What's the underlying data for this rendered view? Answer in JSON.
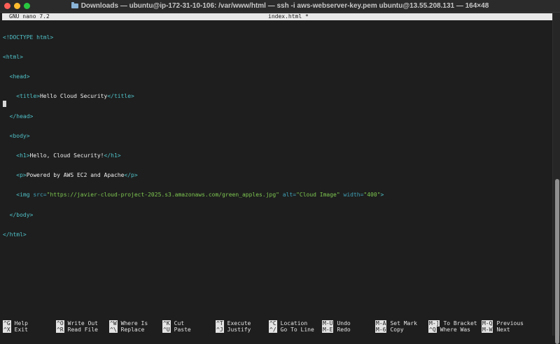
{
  "window": {
    "title": "Downloads — ubuntu@ip-172-31-10-106: /var/www/html — ssh -i aws-webserver-key.pem ubuntu@13.55.208.131 — 164×48"
  },
  "nano": {
    "version": "GNU nano 7.2",
    "filename": "index.html *"
  },
  "code_lines": [
    "<!DOCTYPE html>",
    "<html>",
    "  <head>",
    "    <title>Hello Cloud Security</title>",
    "  </head>",
    "  <body>",
    "    <h1>Hello, Cloud Security!</h1>",
    "    <p>Powered by AWS EC2 and Apache</p>",
    "    <img src=\"https://javier-cloud-project-2025.s3.amazonaws.com/green_apples.jpg\" alt=\"Cloud Image\" width=\"400\">",
    "  </body>",
    "</html>"
  ],
  "shortcuts": [
    {
      "key": "^G",
      "label": "Help"
    },
    {
      "key": "^X",
      "label": "Exit"
    },
    {
      "key": "^O",
      "label": "Write Out"
    },
    {
      "key": "^R",
      "label": "Read File"
    },
    {
      "key": "^W",
      "label": "Where Is"
    },
    {
      "key": "^\\",
      "label": "Replace"
    },
    {
      "key": "^K",
      "label": "Cut"
    },
    {
      "key": "^U",
      "label": "Paste"
    },
    {
      "key": "^T",
      "label": "Execute"
    },
    {
      "key": "^J",
      "label": "Justify"
    },
    {
      "key": "^C",
      "label": "Location"
    },
    {
      "key": "^/",
      "label": "Go To Line"
    },
    {
      "key": "M-U",
      "label": "Undo"
    },
    {
      "key": "M-E",
      "label": "Redo"
    },
    {
      "key": "M-A",
      "label": "Set Mark"
    },
    {
      "key": "M-6",
      "label": "Copy"
    },
    {
      "key": "M-]",
      "label": "To Bracket"
    },
    {
      "key": "^Q",
      "label": "Where Was"
    },
    {
      "key": "M-Q",
      "label": "Previous"
    },
    {
      "key": "M-W",
      "label": "Next"
    }
  ]
}
